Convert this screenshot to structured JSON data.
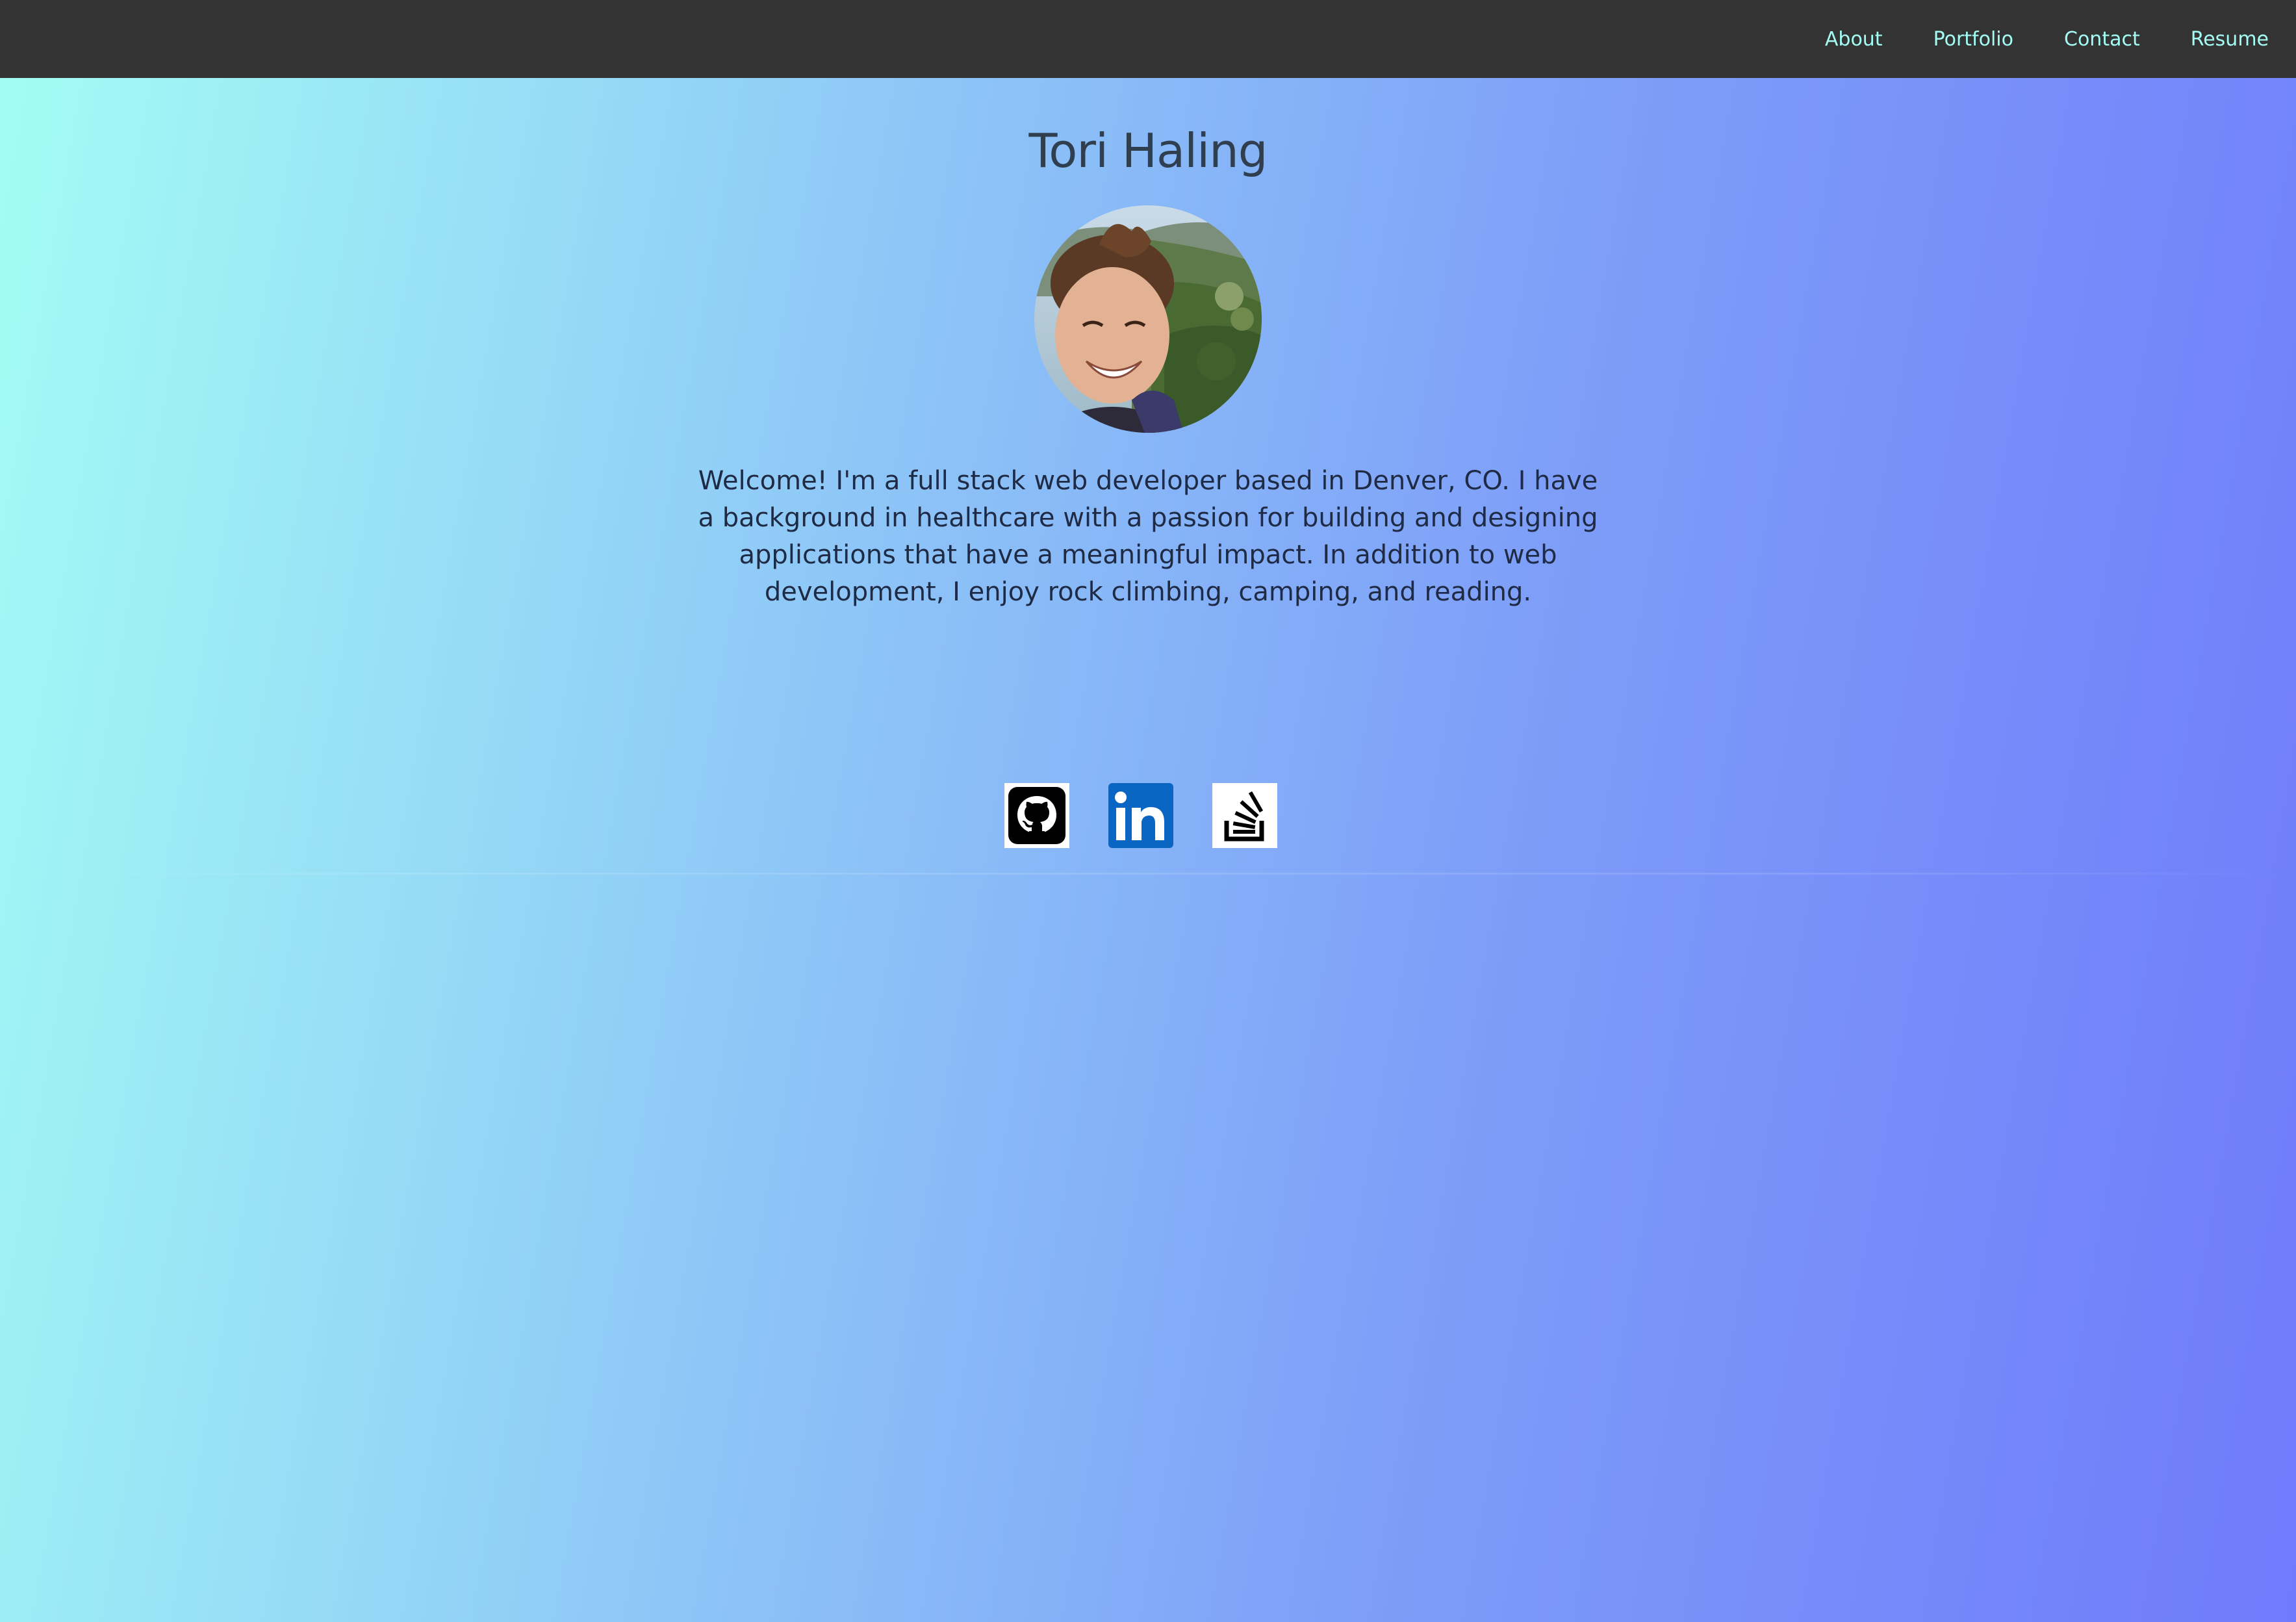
{
  "nav": {
    "links": [
      {
        "label": "About"
      },
      {
        "label": "Portfolio"
      },
      {
        "label": "Contact"
      },
      {
        "label": "Resume"
      }
    ]
  },
  "hero": {
    "name": "Tori Haling",
    "bio": "Welcome! I'm a full stack web developer based in Denver, CO. I have a background in healthcare with a passion for building and designing applications that have a meaningful impact. In addition to web development, I enjoy rock climbing, camping, and reading."
  },
  "socials": [
    {
      "icon": "github-icon"
    },
    {
      "icon": "linkedin-icon"
    },
    {
      "icon": "stackoverflow-icon"
    }
  ],
  "colors": {
    "navbar_bg": "#333333",
    "nav_link": "#a3fdf4",
    "gradient_start": "#a3fdf4",
    "gradient_end": "#6f7bfb",
    "name_text": "#2f3f4f",
    "bio_text": "#1f2a44",
    "linkedin_blue": "#0a66c2"
  }
}
